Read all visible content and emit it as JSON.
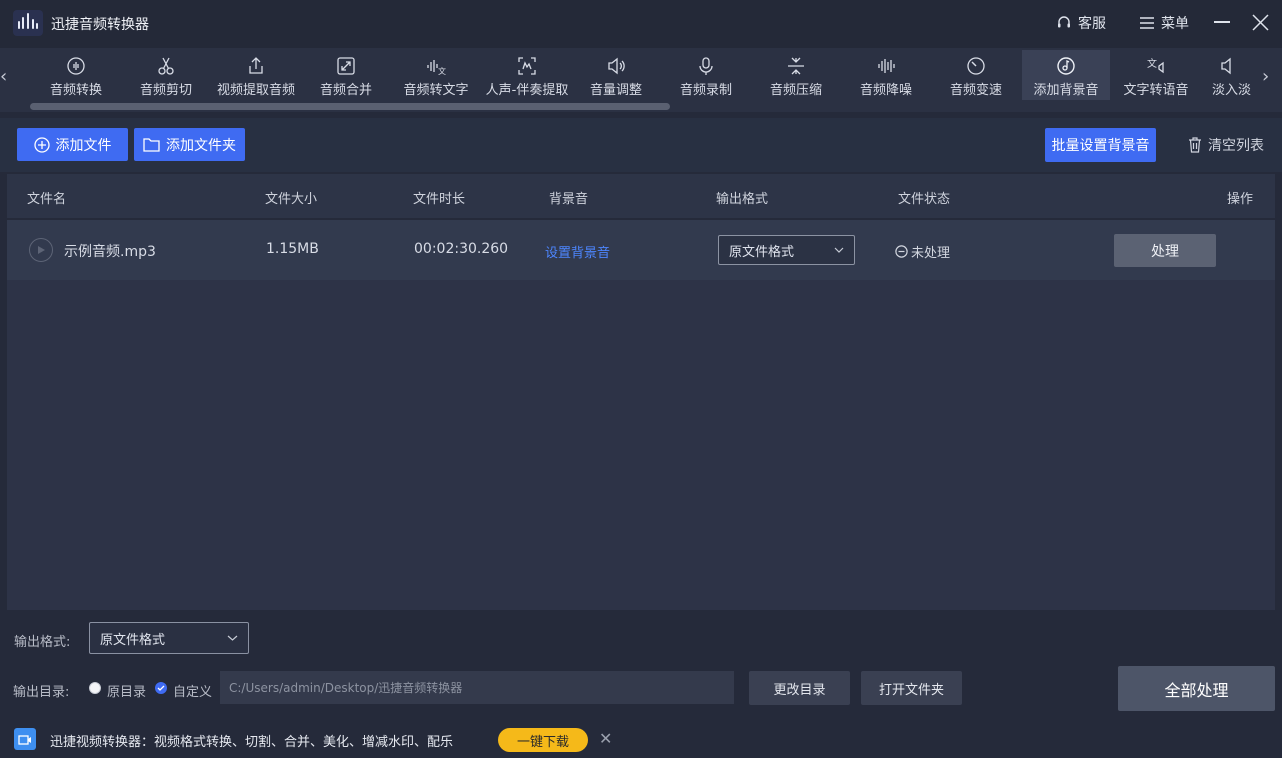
{
  "app": {
    "title": "迅捷音频转换器"
  },
  "titlebar": {
    "service_label": "客服",
    "menu_label": "菜单"
  },
  "toolbar": {
    "items": [
      {
        "label": "音频转换",
        "icon": "audio-convert-icon"
      },
      {
        "label": "音频剪切",
        "icon": "scissors-icon"
      },
      {
        "label": "视频提取音频",
        "icon": "upload-icon"
      },
      {
        "label": "音频合并",
        "icon": "merge-icon"
      },
      {
        "label": "音频转文字",
        "icon": "speech-to-text-icon"
      },
      {
        "label": "人声-伴奏提取",
        "icon": "voice-separate-icon"
      },
      {
        "label": "音量调整",
        "icon": "volume-icon"
      },
      {
        "label": "音频录制",
        "icon": "microphone-icon"
      },
      {
        "label": "音频压缩",
        "icon": "compress-icon"
      },
      {
        "label": "音频降噪",
        "icon": "noise-reduce-icon"
      },
      {
        "label": "音频变速",
        "icon": "speed-icon"
      },
      {
        "label": "添加背景音",
        "icon": "music-disc-icon",
        "active": true
      },
      {
        "label": "文字转语音",
        "icon": "text-to-speech-icon"
      },
      {
        "label": "淡入淡",
        "icon": "fade-icon"
      }
    ]
  },
  "actions": {
    "add_file": "添加文件",
    "add_folder": "添加文件夹",
    "batch_bg": "批量设置背景音",
    "clear_list": "清空列表"
  },
  "table": {
    "headers": {
      "name": "文件名",
      "size": "文件大小",
      "duration": "文件时长",
      "bg": "背景音",
      "format": "输出格式",
      "status": "文件状态",
      "ops": "操作"
    },
    "rows": [
      {
        "name": "示例音频.mp3",
        "size": "1.15MB",
        "duration": "00:02:30.260",
        "bg_link": "设置背景音",
        "format": "原文件格式",
        "status": "未处理",
        "action": "处理"
      }
    ]
  },
  "bottom": {
    "output_format_label": "输出格式:",
    "output_format_value": "原文件格式",
    "output_dir_label": "输出目录:",
    "radio_original": "原目录",
    "radio_custom": "自定义",
    "path": "C:/Users/admin/Desktop/迅捷音频转换器",
    "change_dir": "更改目录",
    "open_folder": "打开文件夹",
    "process_all": "全部处理"
  },
  "promo": {
    "text": "迅捷视频转换器：视频格式转换、切割、合并、美化、增减水印、配乐",
    "button": "一键下载"
  },
  "colors": {
    "accent": "#3f6bf2",
    "link": "#4d86ff",
    "promo": "#f5b919"
  }
}
